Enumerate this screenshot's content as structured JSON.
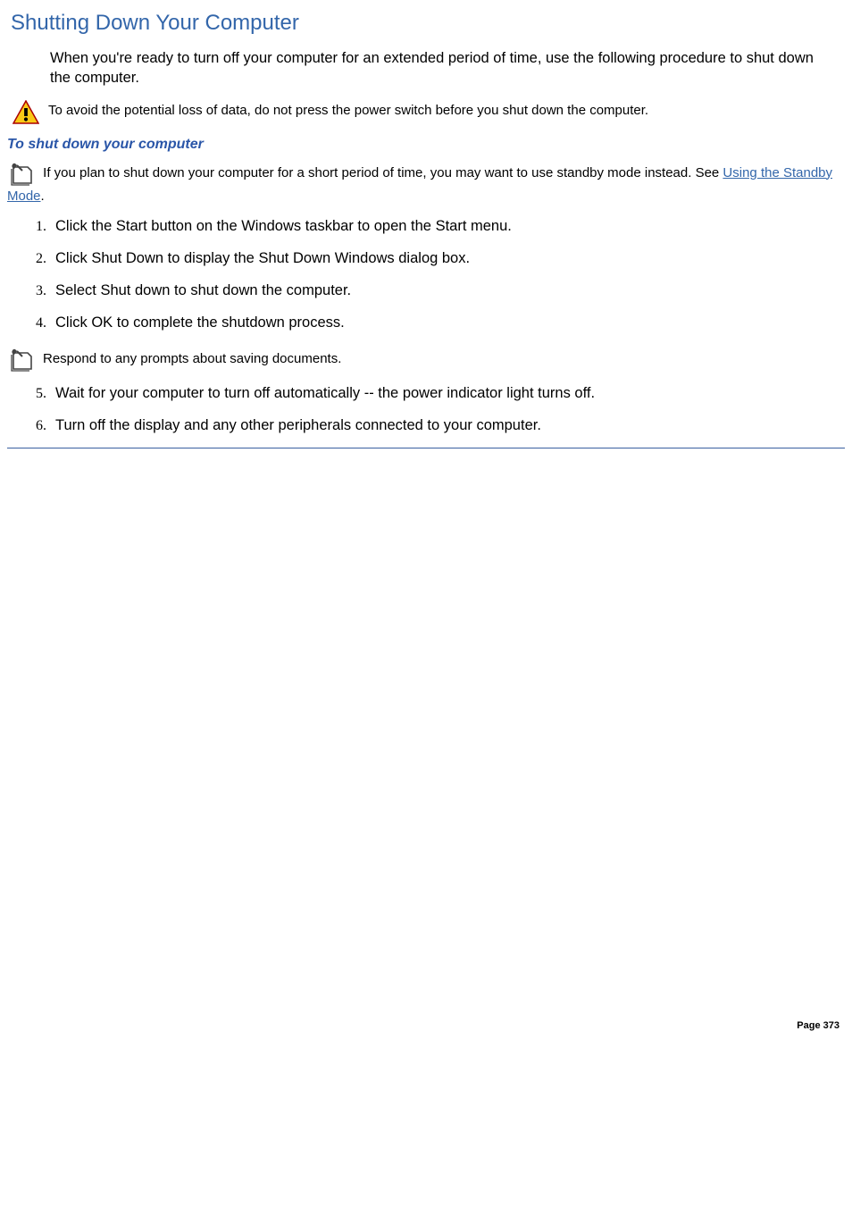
{
  "title": "Shutting Down Your Computer",
  "intro": "When you're ready to turn off your computer for an extended period of time, use the following procedure to shut down the computer.",
  "caution_text": "To avoid the potential loss of data, do not press the power switch before you shut down the computer.",
  "subheading": "To shut down your computer",
  "note1_prefix": "If you plan to shut down your computer for a short period of time, you may want to use standby mode instead. See ",
  "note1_link": "Using the Standby Mode",
  "note1_suffix": ".",
  "steps_a": [
    "Click the Start button on the Windows taskbar to open the Start menu.",
    "Click Shut Down to display the Shut Down Windows dialog box.",
    "Select Shut down to shut down the computer.",
    "Click OK to complete the shutdown process."
  ],
  "note2": "Respond to any prompts about saving documents.",
  "steps_b": [
    "Wait for your computer to turn off automatically -- the power indicator light turns off.",
    "Turn off the display and any other peripherals connected to your computer."
  ],
  "page_label": "Page 373"
}
